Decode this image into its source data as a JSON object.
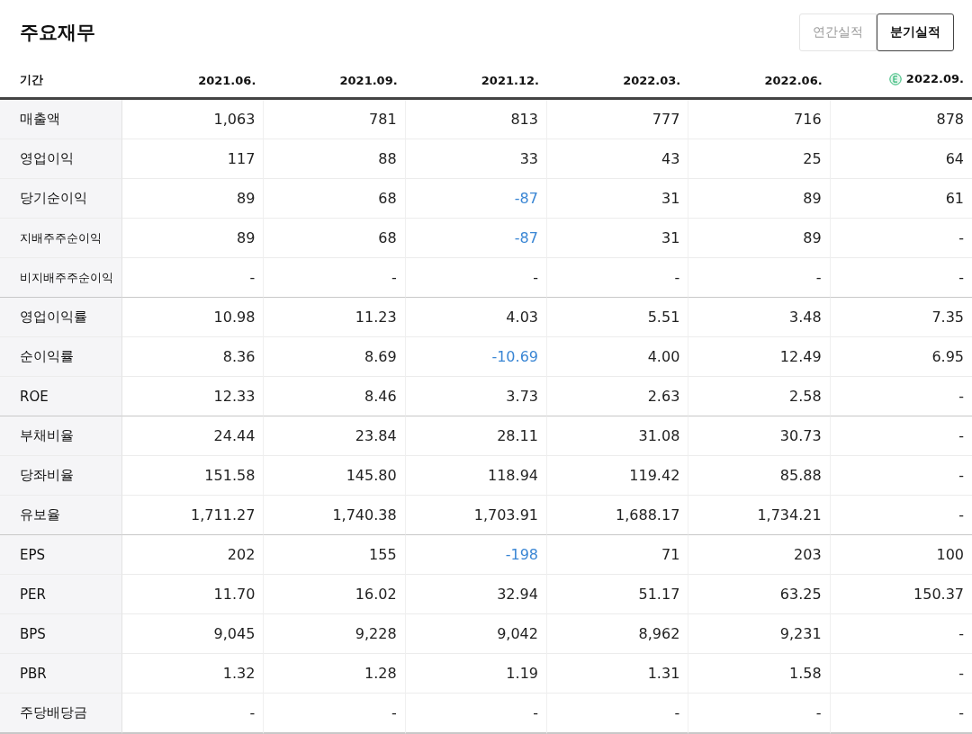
{
  "title": "주요재무",
  "toggle": [
    {
      "label": "연간실적",
      "selected": false
    },
    {
      "label": "분기실적",
      "selected": true
    }
  ],
  "table": {
    "columns": [
      {
        "label": "기간",
        "estimate": false
      },
      {
        "label": "2021.06.",
        "estimate": false
      },
      {
        "label": "2021.09.",
        "estimate": false
      },
      {
        "label": "2021.12.",
        "estimate": false
      },
      {
        "label": "2022.03.",
        "estimate": false
      },
      {
        "label": "2022.06.",
        "estimate": false
      },
      {
        "label": "2022.09.",
        "estimate": true
      }
    ],
    "rows": [
      {
        "label": "매출액",
        "small": false,
        "group_end": false,
        "values": [
          "1,063",
          "781",
          "813",
          "777",
          "716",
          "878"
        ]
      },
      {
        "label": "영업이익",
        "small": false,
        "group_end": false,
        "values": [
          "117",
          "88",
          "33",
          "43",
          "25",
          "64"
        ]
      },
      {
        "label": "당기순이익",
        "small": false,
        "group_end": false,
        "values": [
          "89",
          "68",
          "-87",
          "31",
          "89",
          "61"
        ],
        "negative": [
          false,
          false,
          true,
          false,
          false,
          false
        ]
      },
      {
        "label": "지배주주순이익",
        "small": true,
        "group_end": false,
        "values": [
          "89",
          "68",
          "-87",
          "31",
          "89",
          "-"
        ],
        "negative": [
          false,
          false,
          true,
          false,
          false,
          false
        ]
      },
      {
        "label": "비지배주주순이익",
        "small": true,
        "group_end": true,
        "values": [
          "-",
          "-",
          "-",
          "-",
          "-",
          "-"
        ]
      },
      {
        "label": "영업이익률",
        "small": false,
        "group_end": false,
        "values": [
          "10.98",
          "11.23",
          "4.03",
          "5.51",
          "3.48",
          "7.35"
        ]
      },
      {
        "label": "순이익률",
        "small": false,
        "group_end": false,
        "values": [
          "8.36",
          "8.69",
          "-10.69",
          "4.00",
          "12.49",
          "6.95"
        ],
        "negative": [
          false,
          false,
          true,
          false,
          false,
          false
        ]
      },
      {
        "label": "ROE",
        "small": false,
        "group_end": true,
        "values": [
          "12.33",
          "8.46",
          "3.73",
          "2.63",
          "2.58",
          "-"
        ]
      },
      {
        "label": "부채비율",
        "small": false,
        "group_end": false,
        "values": [
          "24.44",
          "23.84",
          "28.11",
          "31.08",
          "30.73",
          "-"
        ]
      },
      {
        "label": "당좌비율",
        "small": false,
        "group_end": false,
        "values": [
          "151.58",
          "145.80",
          "118.94",
          "119.42",
          "85.88",
          "-"
        ]
      },
      {
        "label": "유보율",
        "small": false,
        "group_end": true,
        "values": [
          "1,711.27",
          "1,740.38",
          "1,703.91",
          "1,688.17",
          "1,734.21",
          "-"
        ]
      },
      {
        "label": "EPS",
        "small": false,
        "group_end": false,
        "values": [
          "202",
          "155",
          "-198",
          "71",
          "203",
          "100"
        ],
        "negative": [
          false,
          false,
          true,
          false,
          false,
          false
        ]
      },
      {
        "label": "PER",
        "small": false,
        "group_end": false,
        "values": [
          "11.70",
          "16.02",
          "32.94",
          "51.17",
          "63.25",
          "150.37"
        ]
      },
      {
        "label": "BPS",
        "small": false,
        "group_end": false,
        "values": [
          "9,045",
          "9,228",
          "9,042",
          "8,962",
          "9,231",
          "-"
        ]
      },
      {
        "label": "PBR",
        "small": false,
        "group_end": false,
        "values": [
          "1.32",
          "1.28",
          "1.19",
          "1.31",
          "1.58",
          "-"
        ]
      },
      {
        "label": "주당배당금",
        "small": false,
        "group_end": true,
        "values": [
          "-",
          "-",
          "-",
          "-",
          "-",
          "-"
        ]
      }
    ]
  }
}
